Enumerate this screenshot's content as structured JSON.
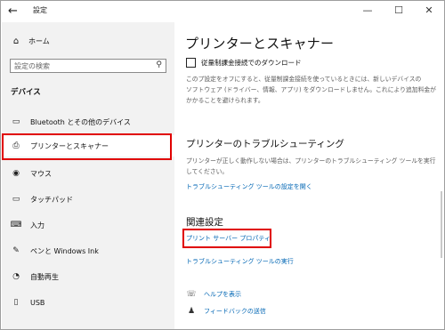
{
  "window": {
    "title": "設定",
    "minimize": "—",
    "maximize": "☐",
    "close": "✕"
  },
  "sidebar": {
    "home_label": "ホーム",
    "search_placeholder": "設定の検索",
    "section_label": "デバイス",
    "items": [
      {
        "label": "Bluetooth とその他のデバイス",
        "icon": "bluetooth-icon"
      },
      {
        "label": "プリンターとスキャナー",
        "icon": "printer-icon",
        "selected": true
      },
      {
        "label": "マウス",
        "icon": "mouse-icon"
      },
      {
        "label": "タッチパッド",
        "icon": "touchpad-icon"
      },
      {
        "label": "入力",
        "icon": "keyboard-icon"
      },
      {
        "label": "ペンと Windows Ink",
        "icon": "pen-icon"
      },
      {
        "label": "自動再生",
        "icon": "autoplay-icon"
      },
      {
        "label": "USB",
        "icon": "usb-icon"
      }
    ]
  },
  "main": {
    "title": "プリンターとスキャナー",
    "metered_checkbox": {
      "label": "従量制課金接続でのダウンロード",
      "checked": false
    },
    "metered_desc": [
      "このプ設定をオフにすると、従量制課金接続を使っているときには、新しいデバイスの",
      "ソフトウェア (ドライバー、情報、アプリ) をダウンロードしません。これにより追加料金が",
      "かかることを避けられます。"
    ],
    "troubleshoot": {
      "heading": "プリンターのトラブルシューティング",
      "desc": "プリンターが正しく動作しない場合は、プリンターのトラブルシューティング ツールを実行してください。",
      "link": "トラブルシューティング ツールの設定を開く"
    },
    "related": {
      "heading": "関連設定",
      "print_server_link": "プリント サーバー プロパティ",
      "run_troubleshooter_link": "トラブルシューティング ツールの実行"
    },
    "help_link": "ヘルプを表示",
    "feedback_link": "フィードバックの送信"
  },
  "colors": {
    "accent_link": "#0066b4",
    "highlight_red": "#e00000",
    "sidebar_bg": "#f2f2f2"
  }
}
